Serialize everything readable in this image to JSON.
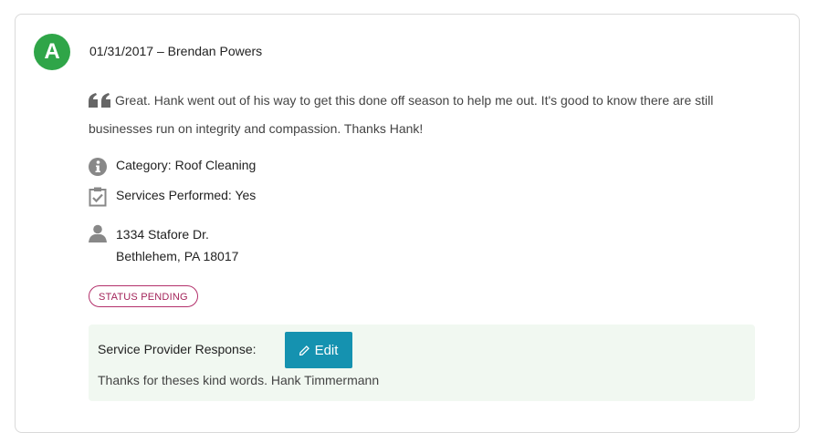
{
  "review": {
    "grade": "A",
    "date": "01/31/2017",
    "separator": "–",
    "author": "Brendan Powers",
    "text": "Great. Hank went out of his way to get this done off season to help me out. It's good to know there are still businesses run on integrity and compassion. Thanks Hank!",
    "category": "Category: Roof Cleaning",
    "services": "Services Performed: Yes",
    "address_line1": "1334 Stafore Dr.",
    "address_line2": "Bethlehem, PA 18017",
    "status": "STATUS PENDING"
  },
  "response": {
    "label": "Service Provider Response:",
    "edit_label": "Edit",
    "text": "Thanks for theses kind words. Hank Timmermann"
  },
  "colors": {
    "grade_bg": "#2fa548",
    "status_accent": "#a3245a",
    "button_bg": "#1592b0",
    "response_bg": "#f1f8f1"
  },
  "icons": [
    "quote-icon",
    "info-icon",
    "clipboard-check-icon",
    "person-icon",
    "pencil-icon"
  ]
}
